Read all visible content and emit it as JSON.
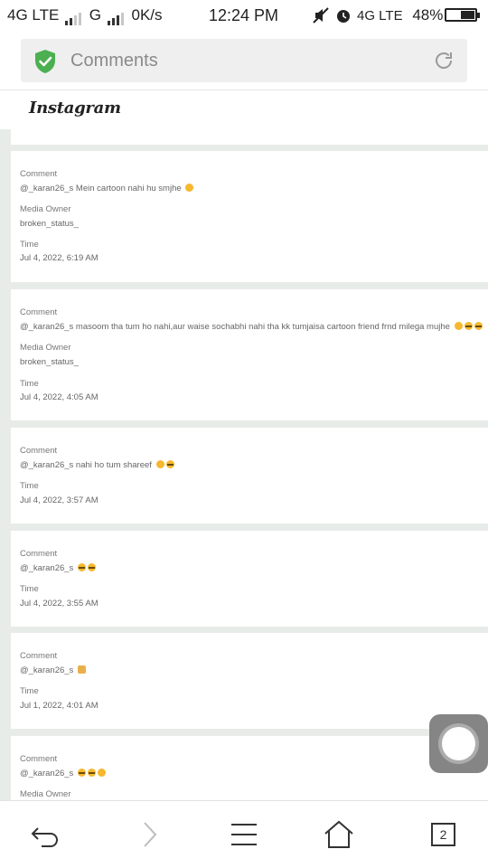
{
  "status_bar": {
    "left": "4G LTE",
    "carrier2": "G",
    "speed": "0K/s",
    "time": "12:24 PM",
    "network_right": "4G LTE",
    "battery": "48%",
    "battery_level": 0.48
  },
  "address_bar": {
    "title": "Comments"
  },
  "header": {
    "logo": "Instagram"
  },
  "comments": [
    {
      "comment_label": "Comment",
      "comment": "@_karan26_s Mein cartoon nahi hu smjhe",
      "emojis": [
        "laugh"
      ],
      "owner_label": "Media Owner",
      "owner": "broken_status_",
      "time_label": "Time",
      "time": "Jul 4, 2022, 6:19 AM"
    },
    {
      "comment_label": "Comment",
      "comment": "@_karan26_s masoom tha tum ho nahi,aur waise sochabhi nahi tha kk tumjaisa cartoon friend frnd milega mujhe",
      "emojis": [
        "laugh",
        "cry",
        "cry"
      ],
      "owner_label": "Media Owner",
      "owner": "broken_status_",
      "time_label": "Time",
      "time": "Jul 4, 2022, 4:05 AM"
    },
    {
      "comment_label": "Comment",
      "comment": "@_karan26_s nahi ho tum shareef",
      "emojis": [
        "laugh",
        "cry"
      ],
      "time_label": "Time",
      "time": "Jul 4, 2022, 3:57 AM"
    },
    {
      "comment_label": "Comment",
      "comment": "@_karan26_s",
      "emojis": [
        "cry",
        "cry"
      ],
      "time_label": "Time",
      "time": "Jul 4, 2022, 3:55 AM"
    },
    {
      "comment_label": "Comment",
      "comment": "@_karan26_s",
      "emojis": [
        "hand"
      ],
      "time_label": "Time",
      "time": "Jul 1, 2022, 4:01 AM"
    },
    {
      "comment_label": "Comment",
      "comment": "@_karan26_s",
      "emojis": [
        "cry",
        "cry",
        "think"
      ],
      "owner_label": "Media Owner"
    }
  ],
  "bottom_nav": {
    "tab_count": "2",
    "icons": [
      "back-icon",
      "forward-icon",
      "menu-icon",
      "home-icon",
      "tabs-icon"
    ]
  },
  "colors": {
    "shield": "#4caf50",
    "feed_bg": "#e8ece9"
  }
}
